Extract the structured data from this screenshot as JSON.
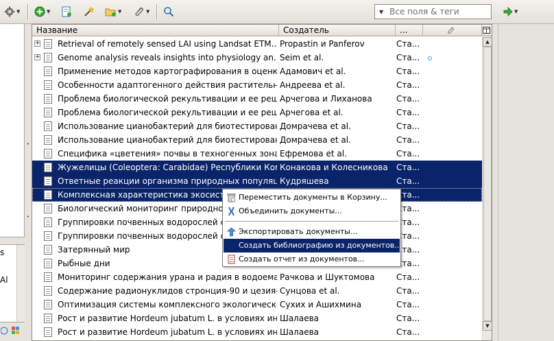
{
  "toolbar": {
    "search_placeholder": "Все поля & теги"
  },
  "columns": {
    "title": "Название",
    "creator": "Создатель",
    "type": "...",
    "attachments_icon": "paperclip-icon",
    "picker_icon": "column-picker-icon"
  },
  "items": [
    {
      "title": "Retrieval of remotely sensed LAI using Landsat ETM...",
      "creator": "Propastin и Panferov",
      "type": "Ста...",
      "expandable": true
    },
    {
      "title": "Genome analysis reveals insights into physiology an...",
      "creator": "Seim et al.",
      "type": "Ста...",
      "expandable": true,
      "attachment": true
    },
    {
      "title": "Применение методов картографирования в оценке...",
      "creator": "Адамович et al.",
      "type": "Ста..."
    },
    {
      "title": "Особенности адаптогенного действия растительн...",
      "creator": "Андреева et al.",
      "type": "Ста..."
    },
    {
      "title": "Проблема биологической рекультивации и ее реш...",
      "creator": "Арчегова и Лиханова",
      "type": "Ста..."
    },
    {
      "title": "Проблема биологической рекультивации и ее реш...",
      "creator": "Арчегова et al.",
      "type": "Ста..."
    },
    {
      "title": "Использование цианобактерий для биотестирован...",
      "creator": "Домрачева et al.",
      "type": "Ста..."
    },
    {
      "title": "Использование цианобактерий для биотестирован...",
      "creator": "Домрачева et al.",
      "type": "Ста..."
    },
    {
      "title": "Специфика «цветения» почвы в техногенных зона...",
      "creator": "Ефремова et al.",
      "type": "Ста..."
    },
    {
      "title": "Жужелицы (Coleoptera: Carabidae) Республики Коми",
      "creator": "Конакова и Колесникова",
      "type": "Ста...",
      "selected": true
    },
    {
      "title": "Ответные реакции организма природных популяци...",
      "creator": "Кудряшева",
      "type": "Ста...",
      "selected": true
    },
    {
      "title": "Комплексная характеристика экосистем...",
      "creator": "",
      "type": "Ста...",
      "selected": true
    },
    {
      "title": "Биологический мониторинг природно-те...",
      "creator": "",
      "type": "Ста..."
    },
    {
      "title": "Группировки почвенных водорослей сел...",
      "creator": "",
      "type": "Ста..."
    },
    {
      "title": "Группировки почвенных водорослей сел...",
      "creator": "",
      "type": "Ста..."
    },
    {
      "title": "Затерянный мир",
      "creator": "",
      "type": "Ста..."
    },
    {
      "title": "Рыбные дни",
      "creator": "",
      "type": "Ста..."
    },
    {
      "title": "Мониторинг содержания урана и радия в водоема...",
      "creator": "Рачкова и Шуктомова",
      "type": "Ста..."
    },
    {
      "title": "Содержание радионуклидов стронция-90 и цезия-...",
      "creator": "Сунцова et al.",
      "type": "Ста..."
    },
    {
      "title": "Оптимизация системы комплексного экологическо...",
      "creator": "Сухих и Ашихмина",
      "type": "Ста..."
    },
    {
      "title": "Рост и развитие Hordeum jubatum L. в условиях ин...",
      "creator": "Шалаева",
      "type": "Ста..."
    },
    {
      "title": "Рост и развитие Hordeum jubatum L. в условиях ин...",
      "creator": "Шалаева",
      "type": "Ста..."
    }
  ],
  "context_menu": [
    {
      "label": "Переместить документы в Корзину...",
      "icon": "trash-icon"
    },
    {
      "label": "Объединить документы...",
      "icon": "merge-icon"
    },
    {
      "label": "Экспортировать документы...",
      "icon": "export-icon"
    },
    {
      "label": "Создать библиографию из документов...",
      "icon": "bibliography-icon",
      "hover": true
    },
    {
      "label": "Создать отчет из документов...",
      "icon": "report-icon"
    }
  ],
  "tags_pane": {
    "fragments": [
      "s",
      "Al"
    ]
  }
}
